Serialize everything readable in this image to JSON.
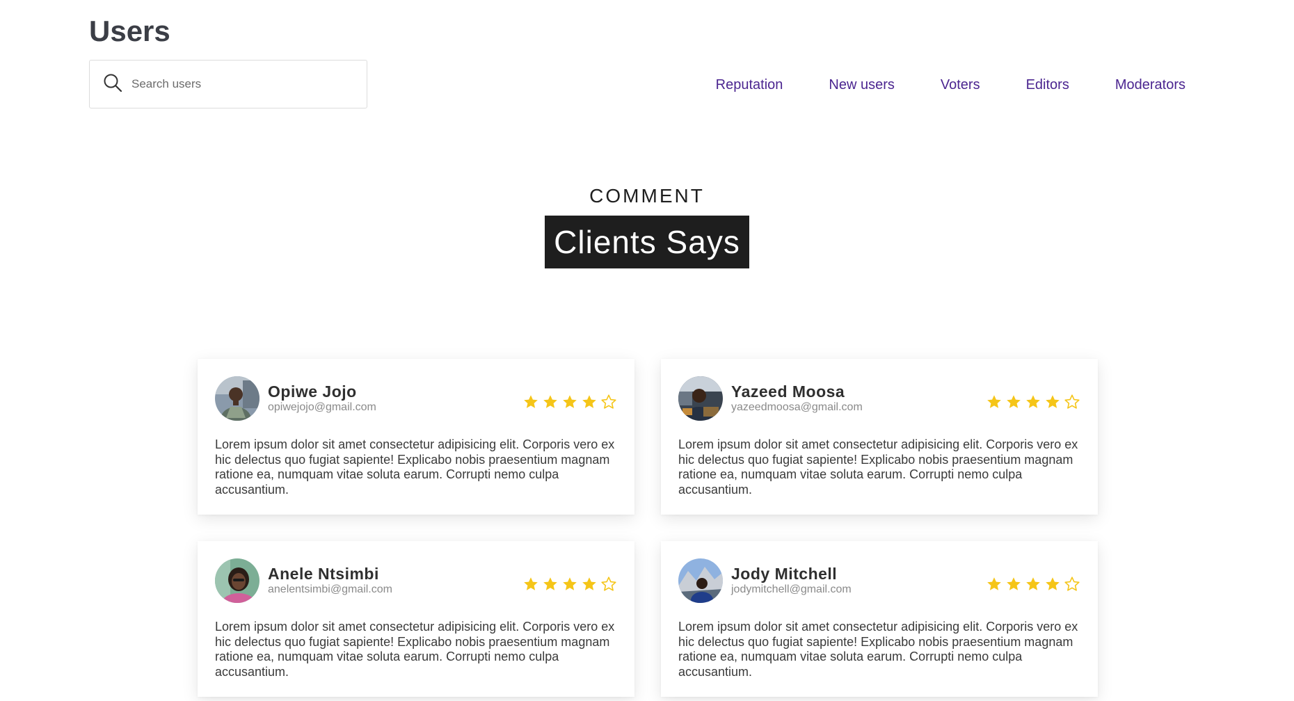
{
  "header": {
    "title": "Users",
    "search_placeholder": "Search users"
  },
  "nav": {
    "items": [
      {
        "label": "Reputation"
      },
      {
        "label": "New users"
      },
      {
        "label": "Voters"
      },
      {
        "label": "Editors"
      },
      {
        "label": "Moderators"
      }
    ]
  },
  "section": {
    "eyebrow": "COMMENT",
    "title": "Clients Says"
  },
  "colors": {
    "nav_link": "#4b2590",
    "star": "#f5c518",
    "headline_bg": "#1e1e1e"
  },
  "testimonials": [
    {
      "name": "Opiwe Jojo",
      "email": "opiwejojo@gmail.com",
      "rating": 4,
      "rating_max": 5,
      "text": "Lorem ipsum dolor sit amet consectetur adipisicing elit. Corporis vero ex hic delectus quo fugiat sapiente! Explicabo nobis praesentium magnam ratione ea, numquam vitae soluta earum. Corrupti nemo culpa accusantium."
    },
    {
      "name": "Yazeed Moosa",
      "email": "yazeedmoosa@gmail.com",
      "rating": 4,
      "rating_max": 5,
      "text": "Lorem ipsum dolor sit amet consectetur adipisicing elit. Corporis vero ex hic delectus quo fugiat sapiente! Explicabo nobis praesentium magnam ratione ea, numquam vitae soluta earum. Corrupti nemo culpa accusantium."
    },
    {
      "name": "Anele Ntsimbi",
      "email": "anelentsimbi@gmail.com",
      "rating": 4,
      "rating_max": 5,
      "text": "Lorem ipsum dolor sit amet consectetur adipisicing elit. Corporis vero ex hic delectus quo fugiat sapiente! Explicabo nobis praesentium magnam ratione ea, numquam vitae soluta earum. Corrupti nemo culpa accusantium."
    },
    {
      "name": "Jody Mitchell",
      "email": "jodymitchell@gmail.com",
      "rating": 4,
      "rating_max": 5,
      "text": "Lorem ipsum dolor sit amet consectetur adipisicing elit. Corporis vero ex hic delectus quo fugiat sapiente! Explicabo nobis praesentium magnam ratione ea, numquam vitae soluta earum. Corrupti nemo culpa accusantium."
    }
  ]
}
